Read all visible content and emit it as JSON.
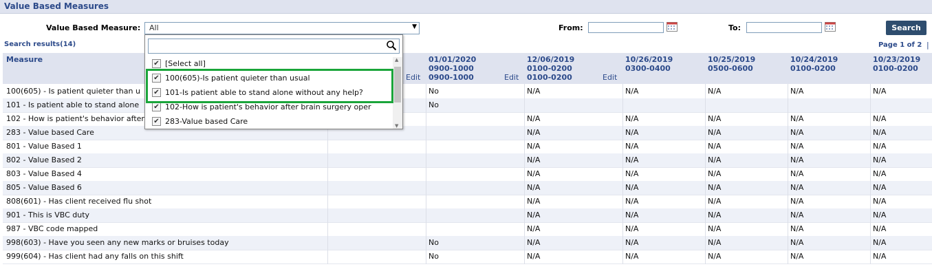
{
  "page_title": "Value Based Measures",
  "filters": {
    "measure_label": "Value Based Measure:",
    "measure_value": "All",
    "from_label": "From:",
    "to_label": "To:",
    "from_value": "",
    "to_value": "",
    "search_button": "Search"
  },
  "search_results": "Search results(14)",
  "page_info": "Page 1 of 2",
  "page_sep": "|",
  "dropdown": {
    "search_value": "",
    "items": [
      {
        "label": "[Select all]",
        "checked": true
      },
      {
        "label": "100(605)-Is patient quieter than usual",
        "checked": true
      },
      {
        "label": "101-Is patient able to stand alone without any help?",
        "checked": true
      },
      {
        "label": "102-How is patient's behavior after brain surgery oper",
        "checked": true
      },
      {
        "label": "283-Value based Care",
        "checked": true
      }
    ]
  },
  "table": {
    "measure_header": "Measure",
    "edit_label": "Edit",
    "columns": [
      {
        "date": "01/01/2020",
        "line2": "0900-1000",
        "line3": "0900-1000"
      },
      {
        "date": "12/06/2019",
        "line2": "0100-0200",
        "line3": "0100-0200"
      },
      {
        "date": "10/26/2019",
        "line2": "0300-0400",
        "line3": ""
      },
      {
        "date": "10/25/2019",
        "line2": "0500-0600",
        "line3": ""
      },
      {
        "date": "10/24/2019",
        "line2": "0100-0200",
        "line3": ""
      },
      {
        "date": "10/23/2019",
        "line2": "0100-0200",
        "line3": ""
      }
    ],
    "rows": [
      {
        "measure": "100(605) - Is patient quieter than u",
        "vals": [
          "No",
          "N/A",
          "N/A",
          "N/A",
          "N/A",
          "N/A"
        ]
      },
      {
        "measure": "101 - Is patient able to stand alone",
        "vals": [
          "No",
          "",
          "",
          "",
          "",
          ""
        ]
      },
      {
        "measure": "102 - How is patient's behavior after",
        "vals": [
          "",
          "N/A",
          "N/A",
          "N/A",
          "N/A",
          "N/A"
        ]
      },
      {
        "measure": "283 - Value based Care",
        "vals": [
          "",
          "N/A",
          "N/A",
          "N/A",
          "N/A",
          "N/A"
        ]
      },
      {
        "measure": "801 - Value Based 1",
        "vals": [
          "",
          "N/A",
          "N/A",
          "N/A",
          "N/A",
          "N/A"
        ]
      },
      {
        "measure": "802 - Value Based 2",
        "vals": [
          "",
          "N/A",
          "N/A",
          "N/A",
          "N/A",
          "N/A"
        ]
      },
      {
        "measure": "803 - Value Based 4",
        "vals": [
          "",
          "N/A",
          "N/A",
          "N/A",
          "N/A",
          "N/A"
        ]
      },
      {
        "measure": "805 - Value Based 6",
        "vals": [
          "",
          "N/A",
          "N/A",
          "N/A",
          "N/A",
          "N/A"
        ]
      },
      {
        "measure": "808(601) - Has client received flu shot",
        "vals": [
          "",
          "N/A",
          "N/A",
          "N/A",
          "N/A",
          "N/A"
        ]
      },
      {
        "measure": "901 - This is VBC duty",
        "vals": [
          "",
          "N/A",
          "N/A",
          "N/A",
          "N/A",
          "N/A"
        ]
      },
      {
        "measure": "987 - VBC code mapped",
        "vals": [
          "",
          "N/A",
          "N/A",
          "N/A",
          "N/A",
          "N/A"
        ]
      },
      {
        "measure": "998(603) - Have you seen any new marks or bruises today",
        "vals": [
          "No",
          "N/A",
          "N/A",
          "N/A",
          "N/A",
          "N/A"
        ]
      },
      {
        "measure": "999(604) - Has client had any falls on this shift",
        "vals": [
          "No",
          "N/A",
          "N/A",
          "N/A",
          "N/A",
          "N/A"
        ]
      }
    ]
  },
  "colors": {
    "accent": "#2c4a8a",
    "header_bg": "#dfe3ef",
    "highlight": "#1aa53a",
    "button": "#2e4d6e"
  }
}
